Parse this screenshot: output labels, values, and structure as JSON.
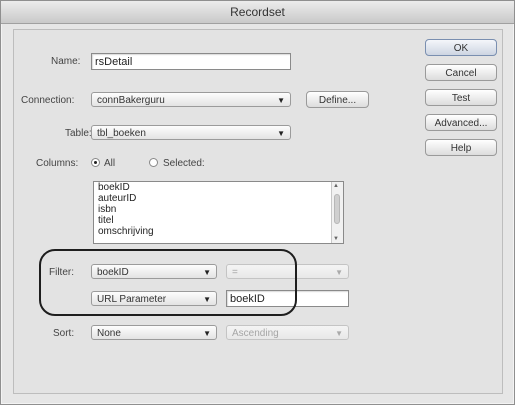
{
  "window": {
    "title": "Recordset"
  },
  "form": {
    "name_label": "Name:",
    "name_value": "rsDetail",
    "connection_label": "Connection:",
    "connection_value": "connBakerguru",
    "define_label": "Define...",
    "table_label": "Table:",
    "table_value": "tbl_boeken",
    "columns_label": "Columns:",
    "columns_all_label": "All",
    "columns_selected_label": "Selected:",
    "columns_mode": "All",
    "column_items": [
      "boekID",
      "auteurID",
      "isbn",
      "titel",
      "omschrijving"
    ],
    "filter_label": "Filter:",
    "filter_column": "boekID",
    "filter_operator": "=",
    "filter_param_type": "URL Parameter",
    "filter_param_value": "boekID",
    "sort_label": "Sort:",
    "sort_value": "None",
    "sort_order": "Ascending"
  },
  "buttons": {
    "ok": "OK",
    "cancel": "Cancel",
    "test": "Test",
    "advanced": "Advanced...",
    "help": "Help"
  },
  "icons": {
    "dropdown": "chevron-down-icon"
  }
}
